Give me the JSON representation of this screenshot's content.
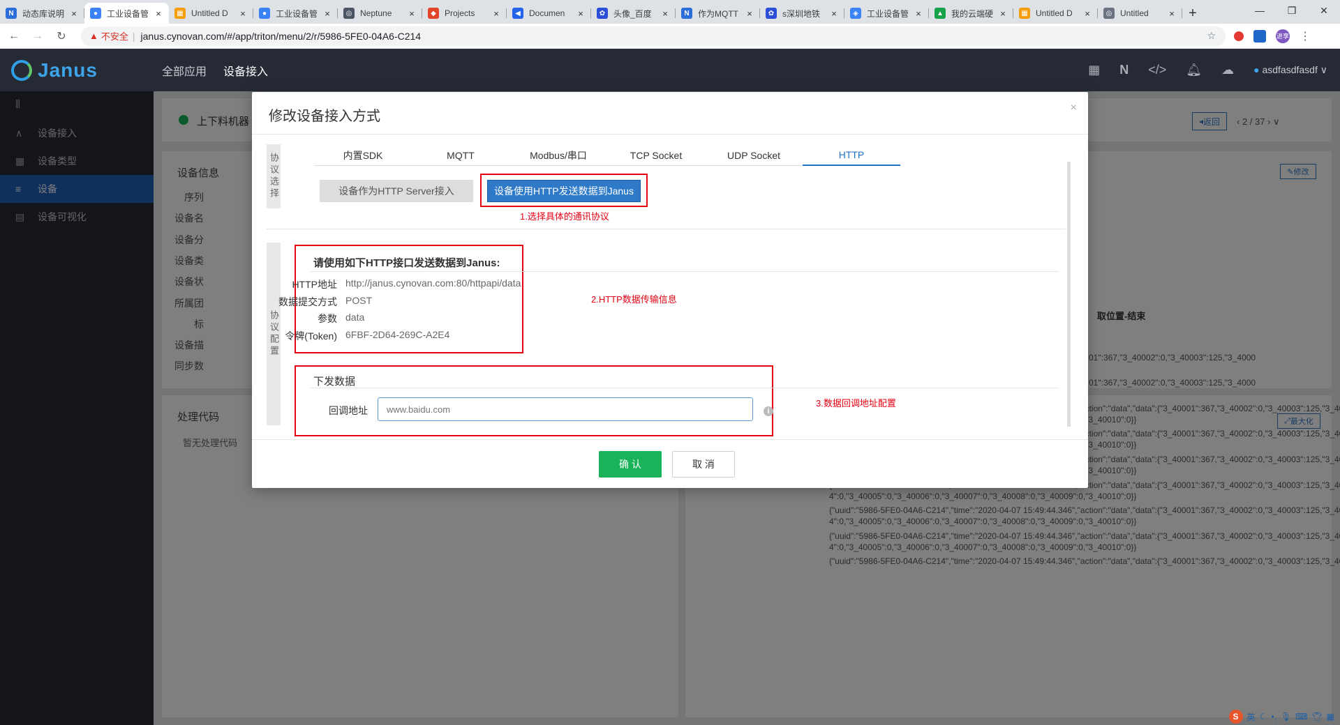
{
  "browser": {
    "tabs": [
      {
        "label": "动态库说明",
        "color": "#2b6dd9",
        "icon": "N"
      },
      {
        "label": "工业设备管",
        "color": "#3b82f6",
        "icon": "●",
        "active": true
      },
      {
        "label": "Untitled D",
        "color": "#f59e0b",
        "icon": "▦"
      },
      {
        "label": "工业设备管",
        "color": "#3b82f6",
        "icon": "●"
      },
      {
        "label": "Neptune",
        "color": "#4b5563",
        "icon": "◎"
      },
      {
        "label": "Projects",
        "color": "#e24329",
        "icon": "◆"
      },
      {
        "label": "Documen",
        "color": "#2563eb",
        "icon": "◀"
      },
      {
        "label": "头像_百度",
        "color": "#2b4fd9",
        "icon": "✿"
      },
      {
        "label": "作为MQTT",
        "color": "#2b6dd9",
        "icon": "N"
      },
      {
        "label": "s深圳地铁",
        "color": "#2b4fd9",
        "icon": "✿"
      },
      {
        "label": "工业设备管",
        "color": "#3b82f6",
        "icon": "◈"
      },
      {
        "label": "我的云端硬",
        "color": "#16a34a",
        "icon": "▲"
      },
      {
        "label": "Untitled D",
        "color": "#f59e0b",
        "icon": "▦"
      },
      {
        "label": "Untitled",
        "color": "#6b7280",
        "icon": "◎"
      }
    ],
    "tab_close": "×",
    "new_tab": "+",
    "win_min": "—",
    "win_max": "❐",
    "win_close": "✕",
    "insecure_label": "不安全",
    "url": "janus.cynovan.com/#/app/triton/menu/2/r/5986-5FE0-04A6-C214",
    "ext_badge": "进享"
  },
  "app": {
    "logo_text": "Janus",
    "nav": [
      "全部应用",
      "设备接入"
    ],
    "user": "asdfasdfasdf"
  },
  "sidebar": {
    "items": [
      {
        "label": "设备接入",
        "icon": "∧"
      },
      {
        "label": "设备类型",
        "icon": "▦"
      },
      {
        "label": "设备",
        "icon": "≡"
      },
      {
        "label": "设备可视化",
        "icon": "▤"
      }
    ]
  },
  "background": {
    "device_title": "上下料机器",
    "back_btn": "返回",
    "pager": "2 / 37",
    "info_heading": "设备信息",
    "edit_btn": "修改",
    "fields": [
      "序列",
      "设备名",
      "设备分",
      "设备类",
      "设备状",
      "所属团",
      "标",
      "设备描",
      "同步数"
    ],
    "location_text": "取位置-结束",
    "process_heading": "处理代码",
    "no_code": "暂无处理代码",
    "maximize": "最大化",
    "log_line1": "{\"uuid\":\"5986-5FE0-04A6-C214\",\"time\":\"2020-04-07 15:49:44.346\",\"action\":\"data\",\"data\":{\"3_40001\":367,\"3_40002\":0,\"3_40003\":125,\"3_4000",
    "log_line2": "4\":0,\"3_40005\":0,\"3_40006\":0,\"3_40007\":0,\"3_40008\":0,\"3_40009\":0,\"3_40010\":0}}",
    "log_partial": "01\":367,\"3_40002\":0,\"3_40003\":125,\"3_4000"
  },
  "modal": {
    "title": "修改设备接入方式",
    "close": "×",
    "label_select": "协议选择",
    "label_config": "协议配置",
    "protocol_tabs": [
      "内置SDK",
      "MQTT",
      "Modbus/串口",
      "TCP Socket",
      "UDP Socket",
      "HTTP"
    ],
    "active_tab": 5,
    "mode_server": "设备作为HTTP Server接入",
    "mode_client": "设备使用HTTP发送数据到Janus",
    "annot1": "1.选择具体的通讯协议",
    "annot2": "2.HTTP数据传输信息",
    "annot3": "3.数据回调地址配置",
    "http_heading": "请使用如下HTTP接口发送数据到Janus:",
    "http_fields": [
      {
        "key": "HTTP地址",
        "value": "http://janus.cynovan.com:80/httpapi/data"
      },
      {
        "key": "数据提交方式",
        "value": "POST"
      },
      {
        "key": "参数",
        "value": "data"
      },
      {
        "key": "令牌(Token)",
        "value": "6FBF-2D64-269C-A2E4"
      }
    ],
    "down_heading": "下发数据",
    "callback_label": "回调地址",
    "callback_placeholder": "www.baidu.com",
    "ok": "确 认",
    "cancel": "取 消"
  },
  "taskbar": {
    "ime": "S",
    "lang": "英"
  }
}
